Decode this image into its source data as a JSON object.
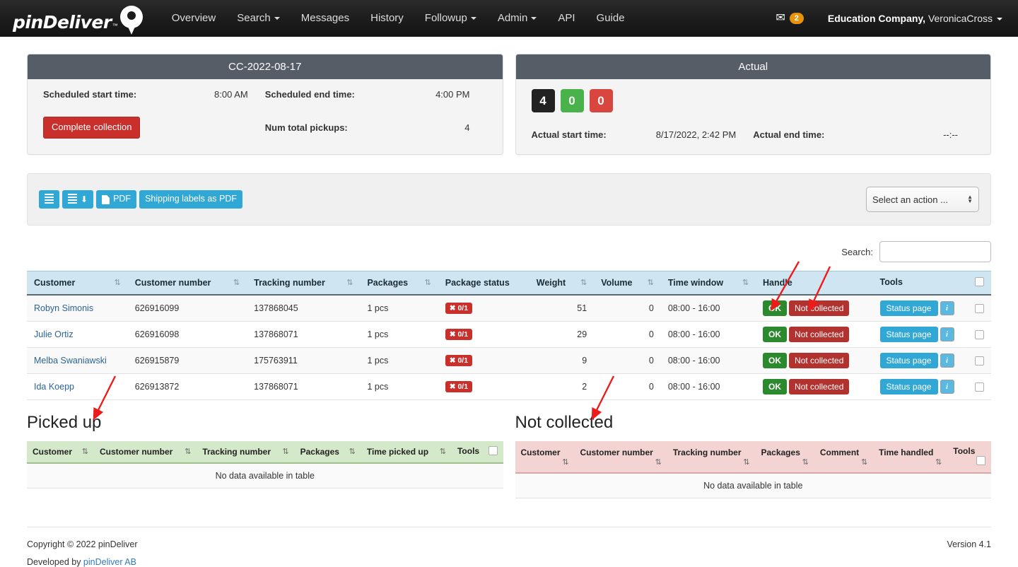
{
  "navbar": {
    "brand": "pinDeliver",
    "brand_tm": "™",
    "links": [
      {
        "label": "Overview",
        "caret": false
      },
      {
        "label": "Search",
        "caret": true
      },
      {
        "label": "Messages",
        "caret": false
      },
      {
        "label": "History",
        "caret": false
      },
      {
        "label": "Followup",
        "caret": true
      },
      {
        "label": "Admin",
        "caret": true
      },
      {
        "label": "API",
        "caret": false
      },
      {
        "label": "Guide",
        "caret": false
      }
    ],
    "mail_icon": "envelope-icon",
    "mail_badge": "2",
    "company": "Education Company,",
    "user": " VeronicaCross"
  },
  "left_panel": {
    "title": "CC-2022-08-17",
    "scheduled_start_label": "Scheduled start time:",
    "scheduled_start_value": "8:00 AM",
    "scheduled_end_label": "Scheduled end time:",
    "scheduled_end_value": "4:00 PM",
    "complete_button": "Complete collection",
    "num_pickups_label": "Num total pickups:",
    "num_pickups_value": "4"
  },
  "right_panel": {
    "title": "Actual",
    "badges": [
      {
        "value": "4",
        "color": "#222222",
        "name": "total-badge"
      },
      {
        "value": "0",
        "color": "#49b24a",
        "name": "picked-up-badge"
      },
      {
        "value": "0",
        "color": "#d9453f",
        "name": "not-collected-badge"
      }
    ],
    "actual_start_label": "Actual start time:",
    "actual_start_value": "8/17/2022, 2:42 PM",
    "actual_end_label": "Actual end time:",
    "actual_end_value": "--:--"
  },
  "toolbar": {
    "list_button": "",
    "list_download_button": "",
    "pdf_button": "PDF",
    "shipping_labels_button": "Shipping labels as PDF",
    "action_select_value": "Select an action ..."
  },
  "search": {
    "label": "Search:",
    "value": "",
    "placeholder": ""
  },
  "main_table": {
    "columns": [
      {
        "label": "Customer",
        "align": "left"
      },
      {
        "label": "Customer number",
        "align": "left"
      },
      {
        "label": "Tracking number",
        "align": "left"
      },
      {
        "label": "Packages",
        "align": "left"
      },
      {
        "label": "Package status",
        "align": "left"
      },
      {
        "label": "Weight",
        "align": "right"
      },
      {
        "label": "Volume",
        "align": "right"
      },
      {
        "label": "Time window",
        "align": "left"
      },
      {
        "label": "Handle",
        "align": "left"
      },
      {
        "label": "Tools",
        "align": "left"
      }
    ],
    "sort_icon": "⇅",
    "rows": [
      {
        "customer": "Robyn Simonis",
        "customer_number": "626916099",
        "tracking_number": "137868045",
        "packages": "1 pcs",
        "package_status": "✖ 0/1",
        "weight": "51",
        "volume": "0",
        "time_window": "08:00 - 16:00",
        "ok_label": "OK",
        "not_collected_label": "Not collected",
        "status_page_label": "Status page",
        "info_label": "i"
      },
      {
        "customer": "Julie Ortiz",
        "customer_number": "626916098",
        "tracking_number": "137868071",
        "packages": "1 pcs",
        "package_status": "✖ 0/1",
        "weight": "29",
        "volume": "0",
        "time_window": "08:00 - 16:00",
        "ok_label": "OK",
        "not_collected_label": "Not collected",
        "status_page_label": "Status page",
        "info_label": "i"
      },
      {
        "customer": "Melba Swaniawski",
        "customer_number": "626915879",
        "tracking_number": "175763911",
        "packages": "1 pcs",
        "package_status": "✖ 0/1",
        "weight": "9",
        "volume": "0",
        "time_window": "08:00 - 16:00",
        "ok_label": "OK",
        "not_collected_label": "Not collected",
        "status_page_label": "Status page",
        "info_label": "i"
      },
      {
        "customer": "Ida Koepp",
        "customer_number": "626913872",
        "tracking_number": "137868071",
        "packages": "1 pcs",
        "package_status": "✖ 0/1",
        "weight": "2",
        "volume": "0",
        "time_window": "08:00 - 16:00",
        "ok_label": "OK",
        "not_collected_label": "Not collected",
        "status_page_label": "Status page",
        "info_label": "i"
      }
    ]
  },
  "picked_up_table": {
    "title": "Picked up",
    "columns": [
      "Customer",
      "Customer number",
      "Tracking number",
      "Packages",
      "Time picked up",
      "Tools"
    ],
    "empty_message": "No data available in table"
  },
  "not_collected_table": {
    "title": "Not collected",
    "columns": [
      "Customer",
      "Customer number",
      "Tracking number",
      "Packages",
      "Comment",
      "Time handled",
      "Tools"
    ],
    "empty_message": "No data available in table"
  },
  "footer": {
    "copyright": "Copyright © 2022 pinDeliver",
    "developed_prefix": "Developed by ",
    "developed_link": "pinDeliver AB",
    "version": "Version 4.1"
  },
  "colors": {
    "navbar_bg": "#1c1c1c",
    "panel_header": "#555d66",
    "accent_blue": "#31a7d6",
    "danger_red": "#c9302c",
    "success_green": "#2b8a2e",
    "badge_orange": "#e8920e",
    "table_header_blue": "#cfe6f2",
    "table_header_green": "#d4e9c9",
    "table_header_pink": "#f4d3d3",
    "annotation_red": "#ee1b1b"
  }
}
